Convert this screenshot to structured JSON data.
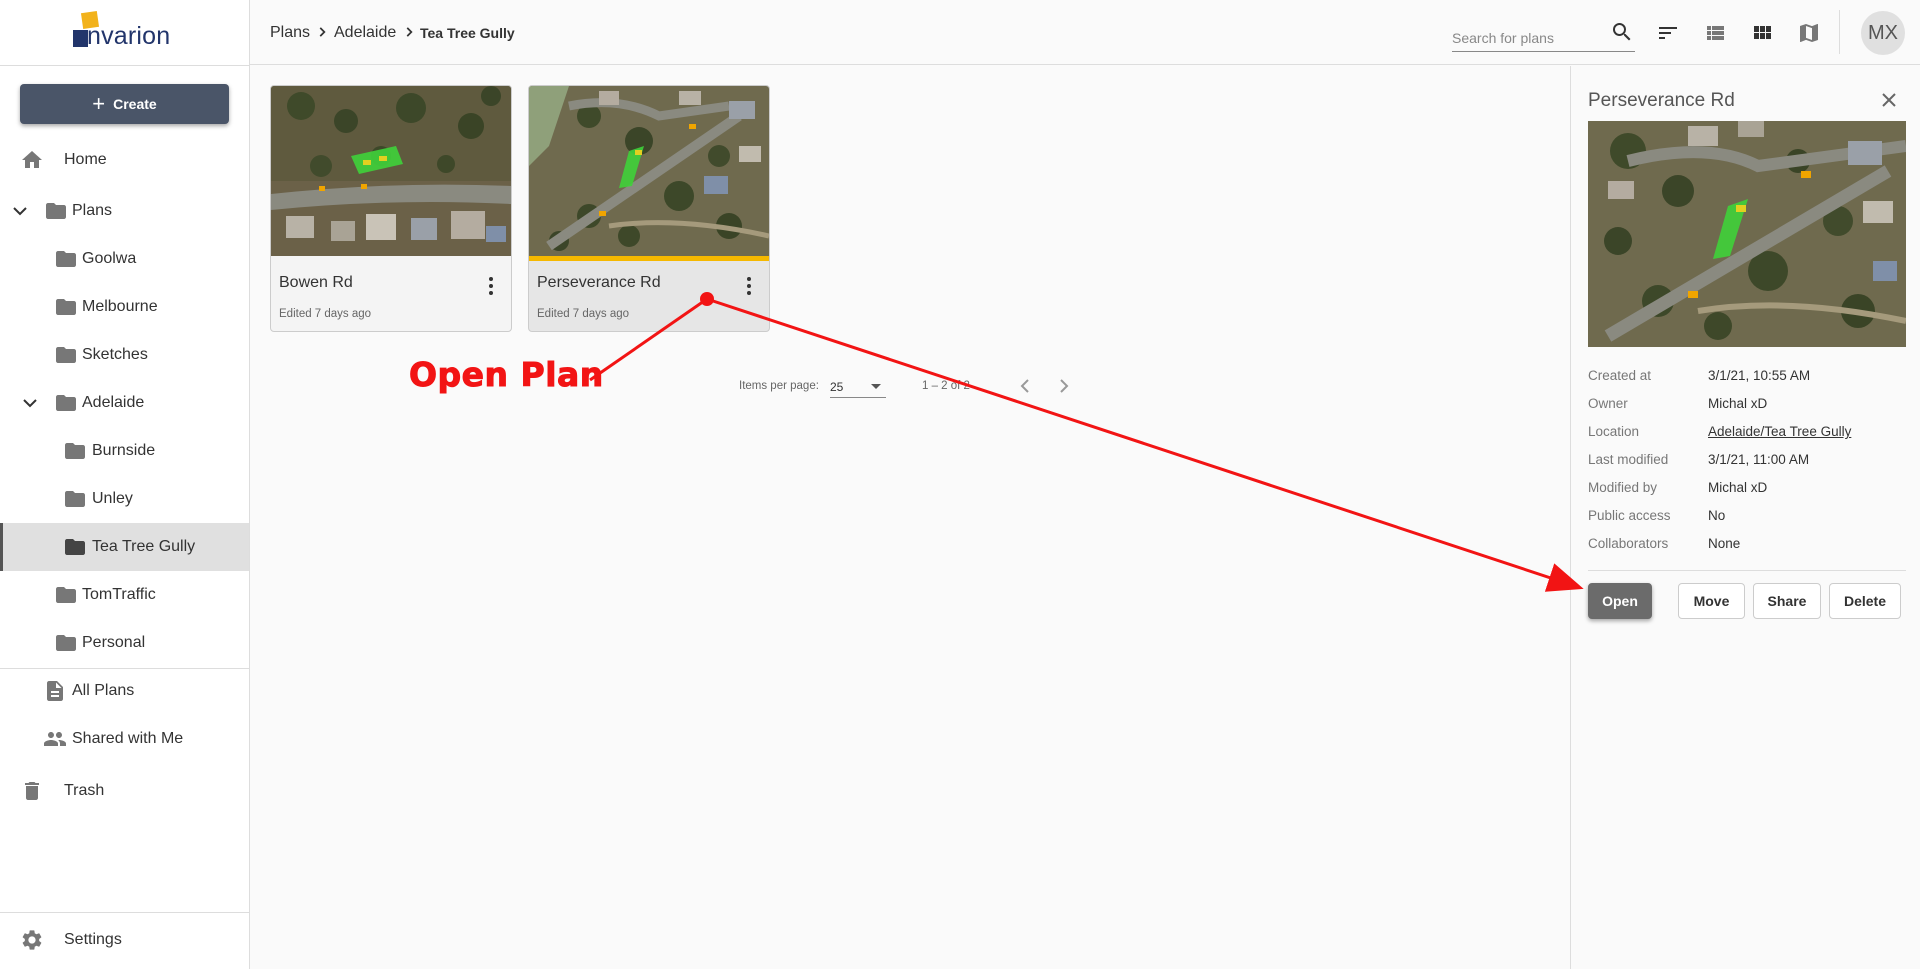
{
  "app": {
    "logo_text": "nvarion"
  },
  "sidebar": {
    "create_label": "Create",
    "home": "Home",
    "plans": "Plans",
    "folders": {
      "goolwa": "Goolwa",
      "melbourne": "Melbourne",
      "sketches": "Sketches",
      "adelaide": "Adelaide",
      "burnside": "Burnside",
      "unley": "Unley",
      "tea_tree_gully": "Tea Tree Gully",
      "tomtraffic": "TomTraffic",
      "personal": "Personal"
    },
    "all_plans": "All Plans",
    "shared_with_me": "Shared with Me",
    "trash": "Trash",
    "settings": "Settings"
  },
  "breadcrumb": {
    "root": "Plans",
    "parent": "Adelaide",
    "current": "Tea Tree Gully"
  },
  "search": {
    "placeholder": "Search for plans"
  },
  "user": {
    "initials": "MX"
  },
  "cards": [
    {
      "title": "Bowen Rd",
      "edited": "Edited 7 days ago"
    },
    {
      "title": "Perseverance Rd",
      "edited": "Edited 7 days ago"
    }
  ],
  "pagination": {
    "items_per_page_label": "Items per page:",
    "items_per_page": "25",
    "range": "1 – 2 of 2"
  },
  "details": {
    "title": "Perseverance Rd",
    "fields": [
      {
        "key": "Created at",
        "value": "3/1/21, 10:55 AM"
      },
      {
        "key": "Owner",
        "value": "Michal xD"
      },
      {
        "key": "Location",
        "value": "Adelaide/Tea Tree Gully"
      },
      {
        "key": "Last modified",
        "value": "3/1/21, 11:00 AM"
      },
      {
        "key": "Modified by",
        "value": "Michal xD"
      },
      {
        "key": "Public access",
        "value": "No"
      },
      {
        "key": "Collaborators",
        "value": "None"
      }
    ],
    "buttons": {
      "open": "Open",
      "move": "Move",
      "share": "Share",
      "delete": "Delete"
    }
  },
  "annotation": {
    "text": "Open Plan",
    "color": "#f21414"
  },
  "colors": {
    "brand_blue": "#22356b",
    "brand_yellow": "#f2b21b",
    "create_button": "#4a5568",
    "card_highlight": "#f5b800"
  }
}
